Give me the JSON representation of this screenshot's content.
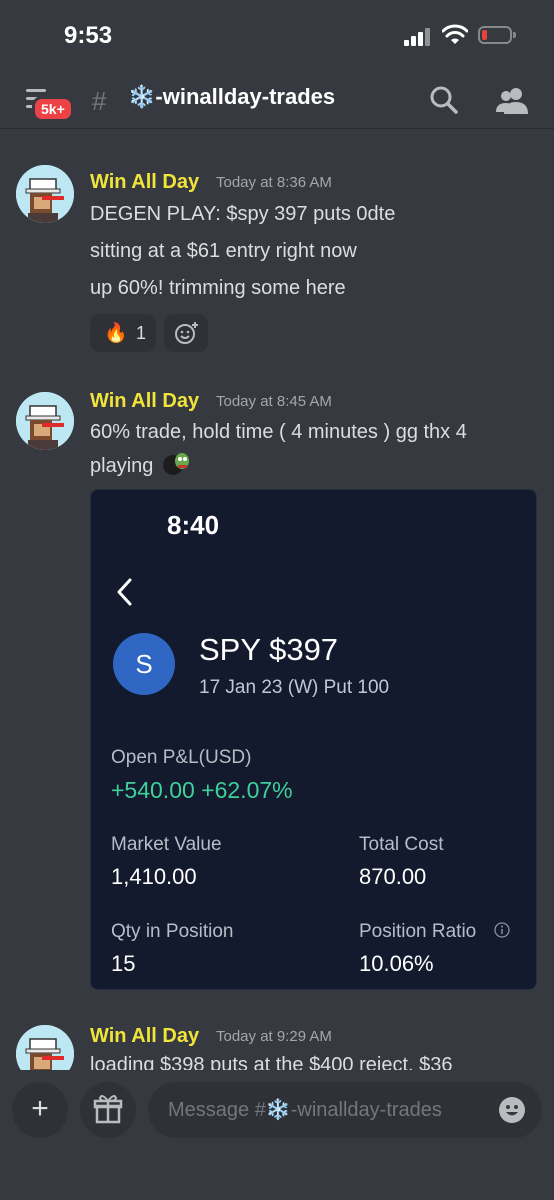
{
  "status_bar": {
    "time": "9:53"
  },
  "header": {
    "badge": "5k+",
    "channel_name": "❄️-winallday-trades"
  },
  "messages": [
    {
      "author": "Win All Day",
      "timestamp": "Today at 8:36 AM",
      "lines": [
        "DEGEN PLAY: $spy 397 puts 0dte",
        "sitting at a $61 entry right now",
        "up 60%! trimming some here"
      ],
      "reaction": {
        "emoji": "🔥",
        "count": "1"
      }
    },
    {
      "author": "Win All Day",
      "timestamp": "Today at 8:45 AM",
      "lines": [
        "60% trade, hold time ( 4 minutes ) gg thx 4",
        "playing"
      ]
    },
    {
      "author": "Win All Day",
      "timestamp": "Today at 9:29 AM",
      "lines": [
        "loading $398 puts at the $400 reject. $36"
      ]
    }
  ],
  "trade_card": {
    "time": "8:40",
    "symbol_initial": "S",
    "symbol": "SPY $397",
    "contract": "17 Jan 23 (W) Put 100",
    "open_pnl_label": "Open P&L(USD)",
    "open_pnl_value": "+540.00 +62.07%",
    "market_value_label": "Market Value",
    "market_value": "1,410.00",
    "total_cost_label": "Total Cost",
    "total_cost": "870.00",
    "qty_label": "Qty in Position",
    "qty": "15",
    "position_ratio_label": "Position Ratio",
    "position_ratio": "10.06%"
  },
  "composer": {
    "placeholder": "Message #❄️-winallday-trades"
  },
  "colors": {
    "background": "#36393f",
    "author": "#f0e43b",
    "card_background": "#131a2e",
    "pnl_green": "#3fcf9a",
    "badge_red": "#ed4245"
  }
}
